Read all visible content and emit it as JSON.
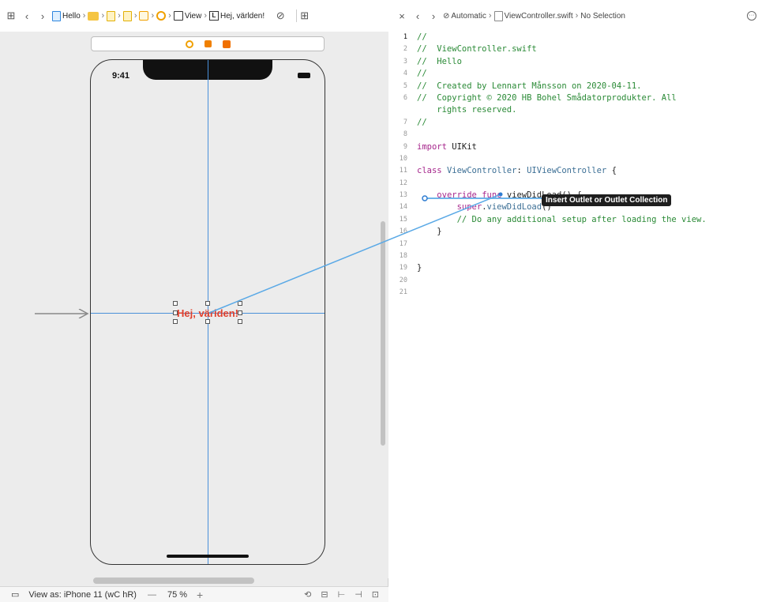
{
  "left_jumpbar": {
    "crumbs": [
      "Hello",
      "",
      "",
      "",
      "",
      "",
      "View",
      "Hej, världen!"
    ]
  },
  "right_jumpbar": {
    "crumbs": [
      "Automatic",
      "ViewController.swift",
      "No Selection"
    ]
  },
  "canvas": {
    "status_time": "9:41",
    "label_text": "Hej, världen!"
  },
  "bottom_bar": {
    "device_label": "View as: iPhone 11 (wC hR)",
    "zoom_minus": "—",
    "zoom_value": "75 %",
    "zoom_plus": "+"
  },
  "tooltip": "Insert Outlet or Outlet Collection",
  "code": [
    {
      "n": "1",
      "html": "<span class='cm'>//</span>"
    },
    {
      "n": "2",
      "html": "<span class='cm'>//  ViewController.swift</span>"
    },
    {
      "n": "3",
      "html": "<span class='cm'>//  Hello</span>"
    },
    {
      "n": "4",
      "html": "<span class='cm'>//</span>"
    },
    {
      "n": "5",
      "html": "<span class='cm'>//  Created by Lennart Månsson on 2020-04-11.</span>"
    },
    {
      "n": "6",
      "html": "<span class='cm'>//  Copyright © 2020 HB Bohel Smådatorprodukter. All</span>"
    },
    {
      "n": "",
      "html": "<span class='cm'>    rights reserved.</span>"
    },
    {
      "n": "7",
      "html": "<span class='cm'>//</span>"
    },
    {
      "n": "8",
      "html": ""
    },
    {
      "n": "9",
      "html": "<span class='kw'>import</span> UIKit"
    },
    {
      "n": "10",
      "html": ""
    },
    {
      "n": "11",
      "html": "<span class='kw'>class</span> <span class='ty'>ViewController</span>: <span class='ty'>UIViewController</span> {"
    },
    {
      "n": "12",
      "html": ""
    },
    {
      "n": "13",
      "html": "    <span class='kw'>override</span> <span class='kw'>func</span> viewDidLoad() {"
    },
    {
      "n": "14",
      "html": "        <span class='kw'>super</span>.<span class='fn'>viewDidLoad</span>()"
    },
    {
      "n": "15",
      "html": "        <span class='cm'>// Do any additional setup after loading the view.</span>"
    },
    {
      "n": "16",
      "html": "    }"
    },
    {
      "n": "17",
      "html": ""
    },
    {
      "n": "18",
      "html": ""
    },
    {
      "n": "19",
      "html": "}"
    },
    {
      "n": "20",
      "html": ""
    },
    {
      "n": "21",
      "html": ""
    }
  ],
  "colors": {
    "comment": "#2a8a36",
    "keyword": "#a6268c",
    "type": "#3c6f95",
    "label": "#e0402d",
    "guide": "#4a90d9",
    "connection": "#5aa9e6"
  },
  "icons": [
    "grid-icon",
    "back-arrow-icon",
    "forward-arrow-icon",
    "file-icon",
    "folder-icon",
    "storyboard-icon",
    "scene-icon",
    "view-controller-icon",
    "view-icon",
    "label-icon",
    "related-items-icon",
    "add-editor-icon",
    "close-icon",
    "gear-icon"
  ]
}
